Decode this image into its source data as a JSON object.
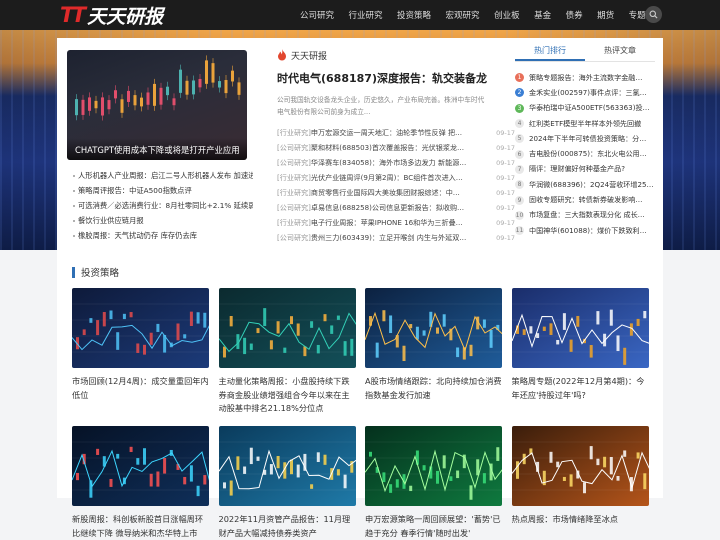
{
  "header": {
    "logo_mark": "TT",
    "logo_text": "天天研报",
    "nav": [
      "公司研究",
      "行业研究",
      "投资策略",
      "宏观研究",
      "创业板",
      "基金",
      "债券",
      "期货",
      "专题"
    ],
    "search_icon": "search-icon"
  },
  "featured": {
    "caption": "CHATGPT使用成本下降或将是打开产业应用",
    "list": [
      "人形机器人产业周报：启江二号人形机器人发布 加速进化",
      "策略周评报告：中证A500指数点评",
      "可选消费／必选消费行业：8月社零同比+2.1% 延续弱复苏",
      "餐饮行业供应链月报",
      "橡胶周报：天气扰动仍存 库存仍去库"
    ]
  },
  "middle": {
    "heading": "天天研报",
    "hot_icon": "flame-icon",
    "top_title": "时代电气(688187)深度报告：轨交装备龙头 …",
    "top_desc": "公司我国轨交设备龙头企业，历史悠久，产业布局完善。株洲中车时代电气股份有限公司前身为成立...",
    "rows": [
      {
        "cat": "[行业研究]",
        "title": "申万宏源交运一周天地汇：油轮季节性反弹 把…",
        "date": "09-17"
      },
      {
        "cat": "[公司研究]",
        "title": "聚和材料(688503)首次覆盖报告：光伏银浆龙…",
        "date": "09-17"
      },
      {
        "cat": "[公司研究]",
        "title": "华泽赛车(834058)：海外市场多边发力 新能源…",
        "date": "09-17"
      },
      {
        "cat": "[行业研究]",
        "title": "光伏产业链周评(9月第2周)：BC组件首次进入…",
        "date": "09-17"
      },
      {
        "cat": "[行业研究]",
        "title": "商贸零售行业国际四大美妆集团财报综述：中…",
        "date": "09-17"
      },
      {
        "cat": "[公司研究]",
        "title": "卓易信息(688258)公司信息更新报告：拟收购…",
        "date": "09-17"
      },
      {
        "cat": "[行业研究]",
        "title": "电子行业周报：苹果IPHONE 16和华为三折叠…",
        "date": "09-17"
      },
      {
        "cat": "[公司研究]",
        "title": "贵州三力(603439)：立足开喉剑 内生与外延双…",
        "date": "09-17"
      }
    ]
  },
  "right": {
    "tabs": [
      "热门排行",
      "热评文章"
    ],
    "active_tab": 0,
    "rank_colors": [
      "#e8705a",
      "#3b7fd4",
      "#5fb85a"
    ],
    "items": [
      "策略专题报告：海外主流数字金融…",
      "金禾实业(002597)事件点评：三氯…",
      "华泰柏瑞中证A500ETF(563363)投…",
      "红利类ETF模型半年样本外领先回撤",
      "2024年下半年可转债投资策略：分…",
      "吉电股份(000875)：东北火电公用…",
      "隔评：理财偏好何种基金产品?",
      "华润微(688396)：2Q24营收环增25…",
      "固收专题研究：转债新券破发影响…",
      "市场复盘：三大指数表现分化 成长…",
      "中国神华(601088)：煤价下跌致利…"
    ]
  },
  "section": {
    "title": "投资策略",
    "items": [
      {
        "title": "市场回顾(12月4周)：成交量重回年内低位",
        "theme": "blue-candle"
      },
      {
        "title": "主动量化策略周报：小盘股持续下跌 券商金股业绩增强组合今年以来在主动股基中排名21.18%分位点",
        "theme": "teal-candle"
      },
      {
        "title": "A股市场情绪跟踪：北向持续加仓消费指数基金发行加速",
        "theme": "blue-line"
      },
      {
        "title": "策略周专题(2022年12月第4期)：今年还应'持股过年'吗?",
        "theme": "ticker"
      },
      {
        "title": "新股周报：科创板新股首日涨幅周环比继续下降 微导纳米和杰华特上市",
        "theme": "dark-candle"
      },
      {
        "title": "2022年11月资管产品报告：11月理财产品大幅减持债券类资产",
        "theme": "quote-board"
      },
      {
        "title": "申万宏源策略一周回顾展望：'蓄势'已趋于充分 春季行情'随时出发'",
        "theme": "green-wave"
      },
      {
        "title": "热点周报：市场情绪降至冰点",
        "theme": "orange-line"
      }
    ]
  }
}
